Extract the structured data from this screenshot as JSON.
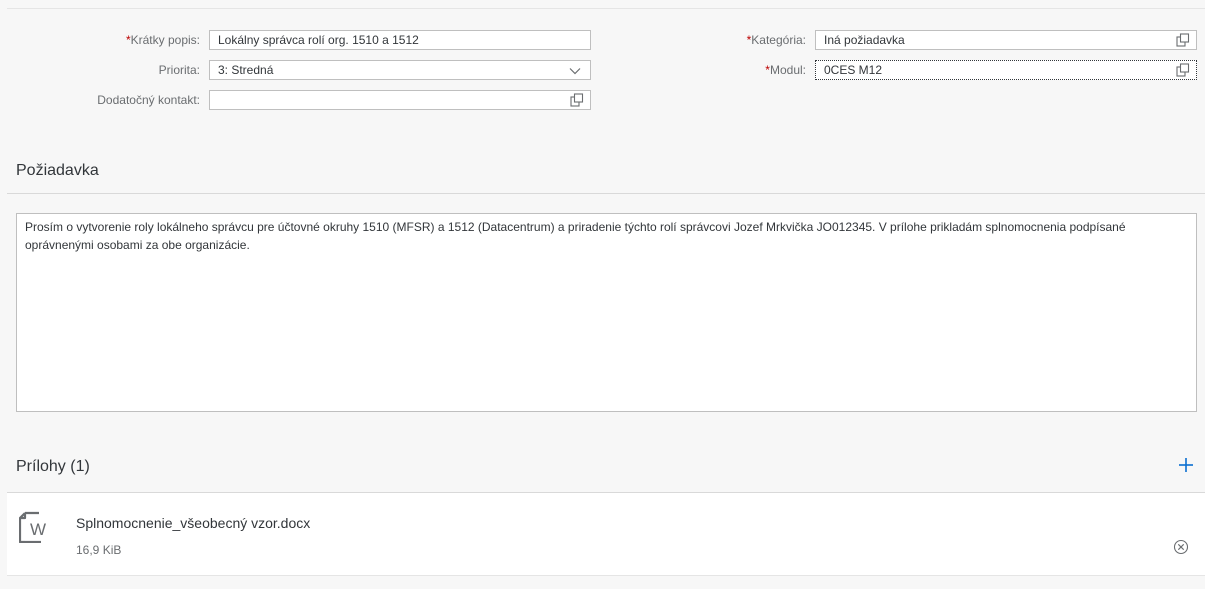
{
  "form": {
    "short_desc": {
      "label": "Krátky popis:",
      "required_mark": "*",
      "value": "Lokálny správca rolí org. 1510 a 1512"
    },
    "priority": {
      "label": "Priorita:",
      "value": "3: Stredná"
    },
    "extra_contact": {
      "label": "Dodatočný kontakt:",
      "value": ""
    },
    "category": {
      "label": "Kategória:",
      "required_mark": "*",
      "value": "Iná požiadavka"
    },
    "module": {
      "label": "Modul:",
      "required_mark": "*",
      "value": "0CES M12"
    }
  },
  "request": {
    "title": "Požiadavka",
    "text": "Prosím o vytvorenie roly lokálneho správcu pre účtovné okruhy 1510 (MFSR) a 1512 (Datacentrum) a priradenie týchto rolí správcovi Jozef Mrkvička JO012345. V prílohe prikladám splnomocnenia podpísané oprávnenými osobami za obe organizácie."
  },
  "attachments": {
    "title": "Prílohy (1)",
    "items": [
      {
        "file_name": "Splnomocnenie_všeobecný vzor.docx",
        "file_size": "16,9 KiB",
        "icon": "word-document-icon"
      }
    ]
  },
  "icons": {
    "value_help": "value-help-icon",
    "dropdown": "chevron-down-icon",
    "add": "add-icon",
    "remove": "remove-circle-icon"
  },
  "colors": {
    "required": "#bb0000",
    "accent": "#0a6ed1"
  }
}
